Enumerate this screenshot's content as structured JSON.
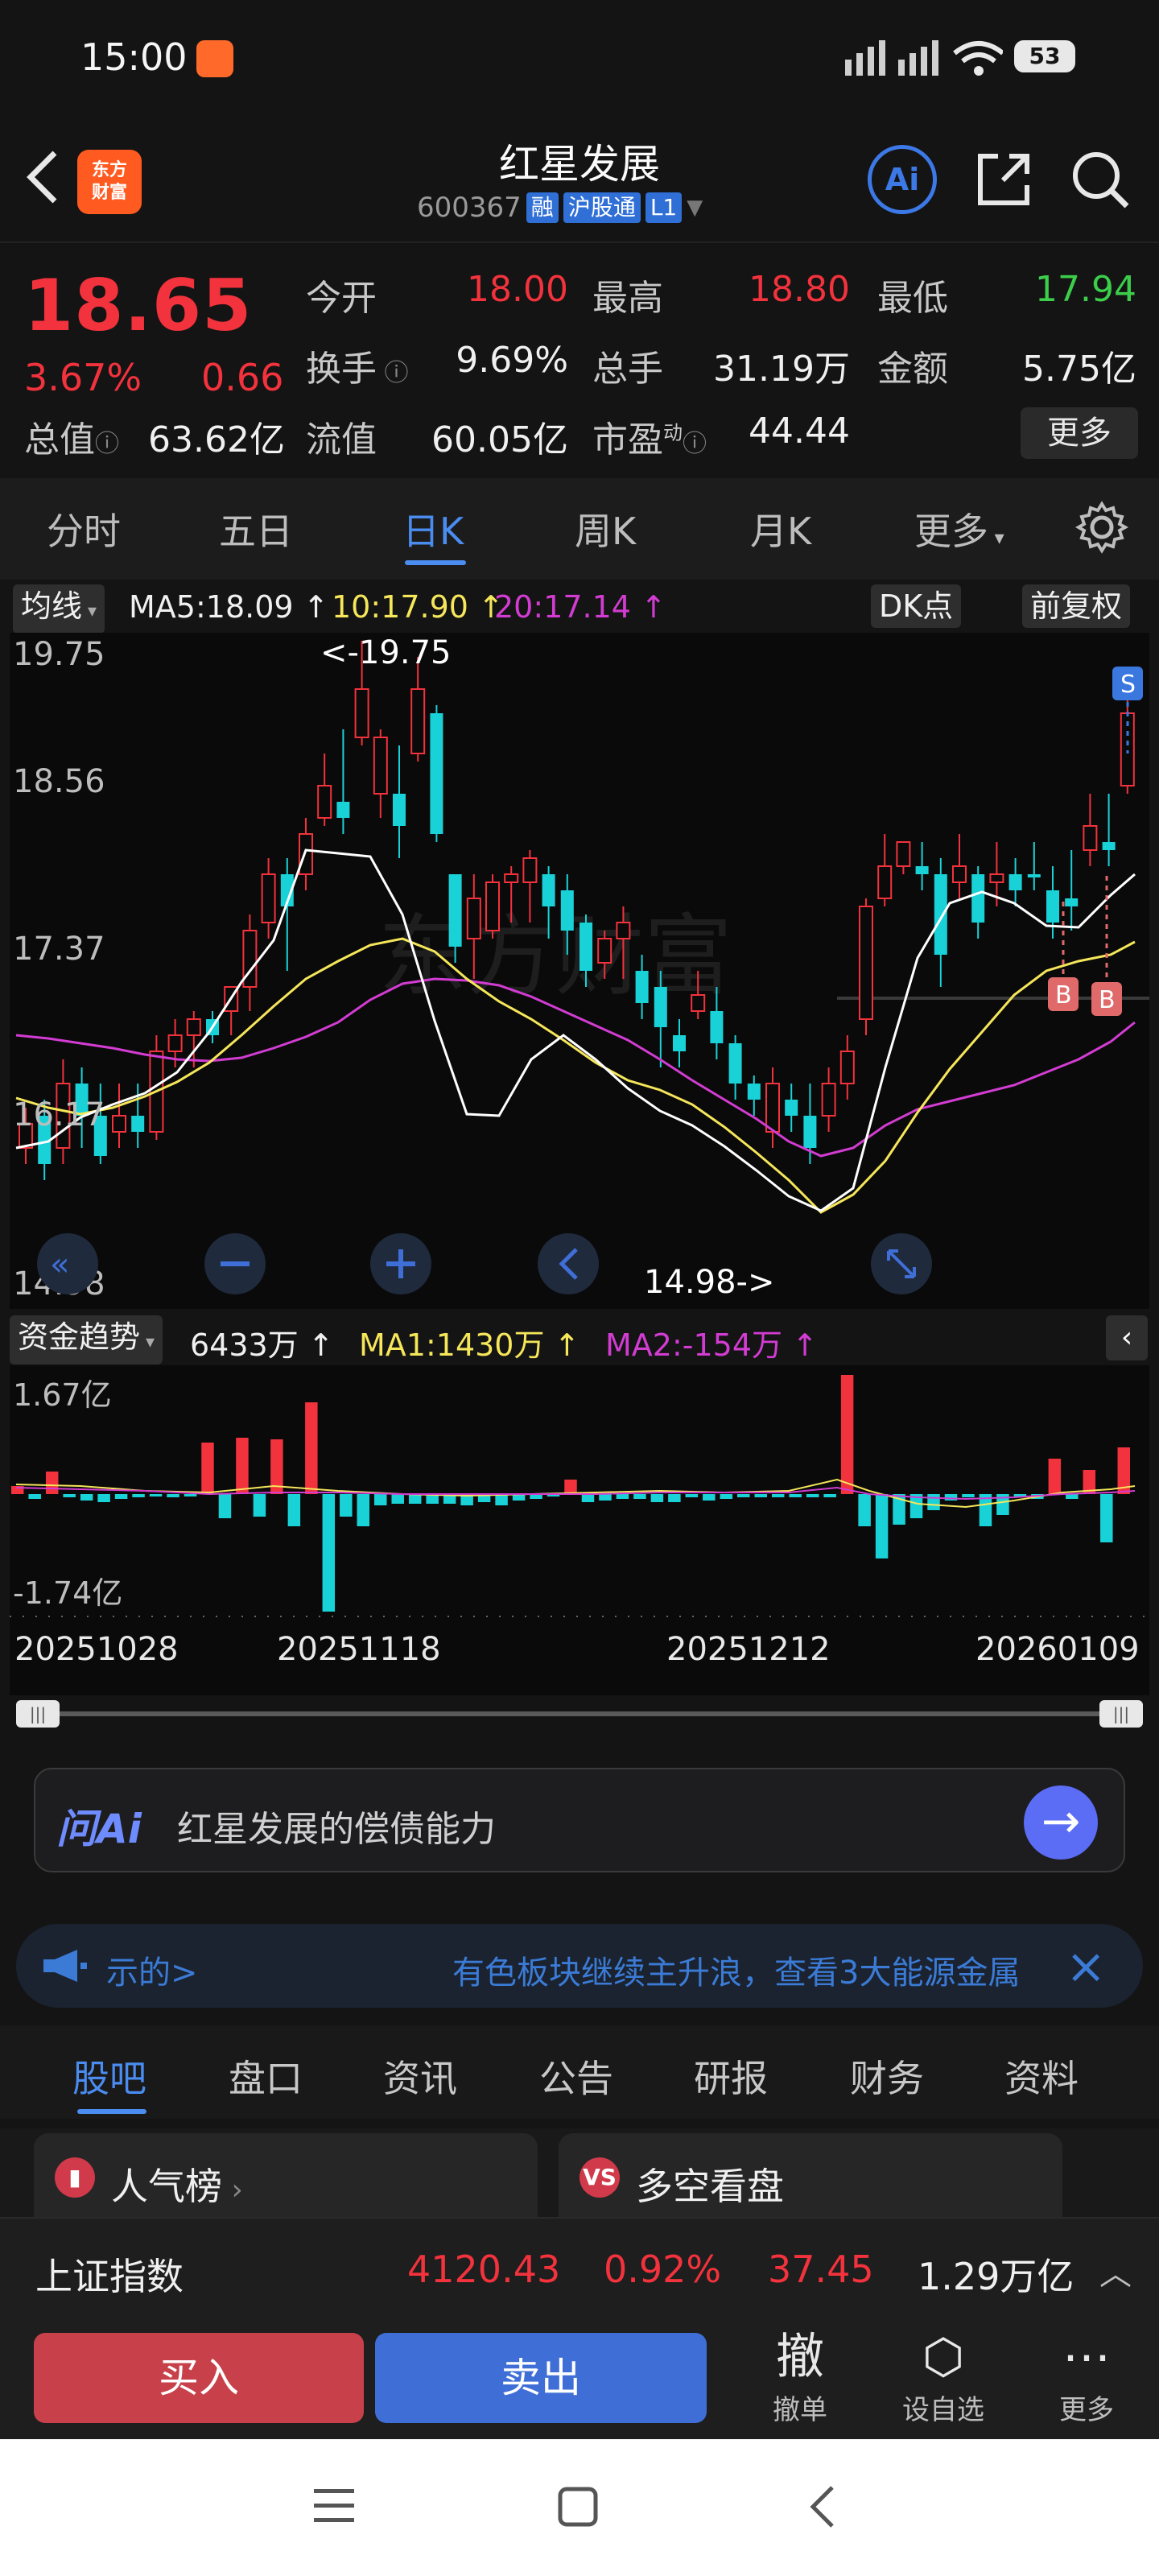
{
  "status": {
    "time": "15:00",
    "battery": "53"
  },
  "header": {
    "logo_top": "东方",
    "logo_bottom": "财富",
    "title": "红星发展",
    "code": "600367",
    "tag_rong": "融",
    "tag_hgt": "沪股通",
    "tag_level": "L1",
    "ai_label": "Ai"
  },
  "quote": {
    "price": "18.65",
    "change_pct": "3.67%",
    "change": "0.66",
    "open_label": "今开",
    "open": "18.00",
    "high_label": "最高",
    "high": "18.80",
    "low_label": "最低",
    "low": "17.94",
    "turnover_label": "换手",
    "turnover": "9.69%",
    "volume_label": "总手",
    "volume": "31.19万",
    "amount_label": "金额",
    "amount": "5.75亿",
    "mktcap_label": "总值",
    "mktcap": "63.62亿",
    "float_label": "流值",
    "float": "60.05亿",
    "pe_label": "市盈",
    "pe_sup": "动",
    "pe": "44.44",
    "more": "更多"
  },
  "period_tabs": [
    "分时",
    "五日",
    "日K",
    "周K",
    "月K",
    "更多"
  ],
  "ma_bar": {
    "selector": "均线",
    "ma5": "MA5:18.09",
    "ma10": "10:17.90",
    "ma20": "20:17.14",
    "dk": "DK点",
    "adjust": "前复权"
  },
  "kchart": {
    "axis_top": "19.75",
    "axis_2": "18.56",
    "axis_3": "17.37",
    "axis_4": "16.17",
    "axis_bottom": "14.98",
    "high_marker": "<-19.75",
    "low_marker": "14.98->",
    "marker_s": "S",
    "marker_b": "B",
    "watermark": "东方财富"
  },
  "flow_bar": {
    "label": "资金趋势",
    "value": "6433万",
    "ma1": "MA1:1430万",
    "ma2": "MA2:-154万"
  },
  "flowchart": {
    "axis_top": "1.67亿",
    "axis_bottom": "-1.74亿"
  },
  "dates": [
    "20251028",
    "20251118",
    "20251212",
    "20260109"
  ],
  "ask_ai": {
    "logo": "问Ai",
    "prompt": "红星发展的偿债能力"
  },
  "ticker": {
    "left": "示的>",
    "main": "有色板块继续主升浪，查看3大能源金属"
  },
  "info_tabs": [
    "股吧",
    "盘口",
    "资讯",
    "公告",
    "研报",
    "财务",
    "资料"
  ],
  "cards": {
    "popular": "人气榜",
    "longshort": "多空看盘"
  },
  "index_bar": {
    "name": "上证指数",
    "value": "4120.43",
    "pct": "0.92%",
    "change": "37.45",
    "amount": "1.29万亿"
  },
  "trade": {
    "buy": "买入",
    "sell": "卖出",
    "cancel_icon": "撤",
    "cancel": "撤单",
    "watch": "设自选",
    "more": "更多"
  },
  "colors": {
    "up": "#f2323c",
    "down": "#19d2d8",
    "ma5": "#ffffff",
    "ma10": "#f5e65a",
    "ma20": "#d23cd2",
    "accent": "#4a8cf0"
  }
}
